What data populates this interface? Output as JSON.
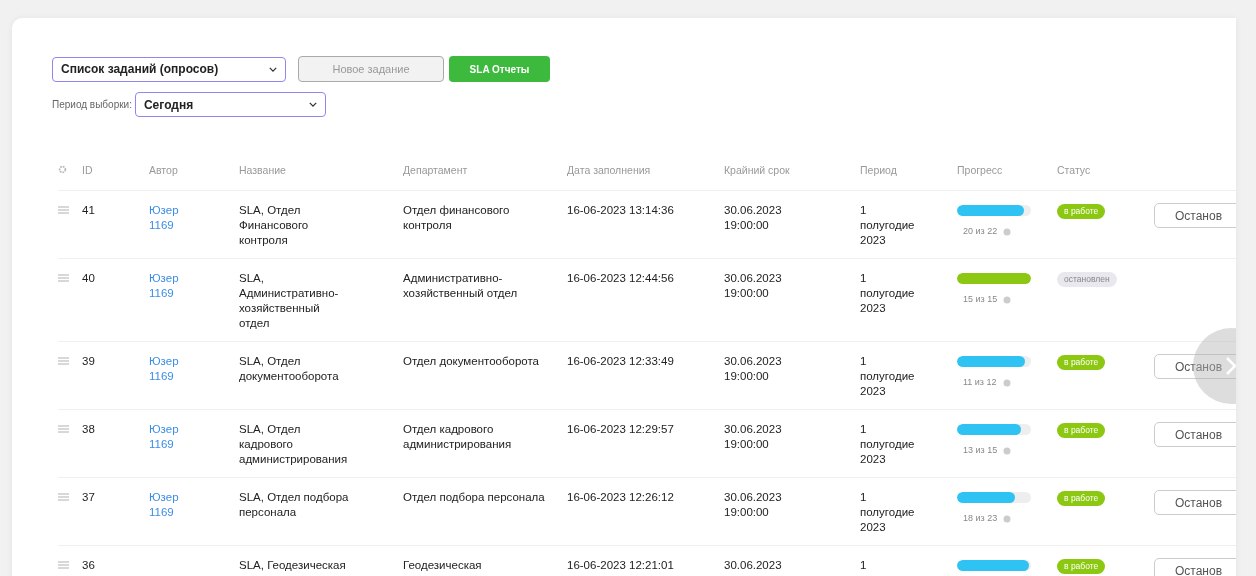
{
  "toolbar": {
    "list_select": {
      "value": "Список заданий (опросов)"
    },
    "buttons": [
      {
        "label": "Новое задание",
        "kind": "secondary"
      },
      {
        "label": "SLA Отчеты",
        "kind": "primary"
      }
    ],
    "period_label": "Период выборки:",
    "period_select": {
      "value": "Сегодня"
    }
  },
  "table": {
    "columns": [
      "ID",
      "Автор",
      "Название",
      "Департамент",
      "Дата заполнения",
      "Крайний срок",
      "Период",
      "Прогресс",
      "Статус"
    ],
    "rows": [
      {
        "id": "41",
        "author": "Юзер 1169",
        "name": "SLA, Отдел Финансового контроля",
        "department": "Отдел финансового контроля",
        "filled": "16-06-2023 13:14:36",
        "deadline": "30.06.2023 19:00:00",
        "period": "1 полугодие 2023",
        "level": 0.91,
        "progress": "20 из 22",
        "status": {
          "label": "в работе",
          "kind": "active"
        },
        "action": "Останов"
      },
      {
        "id": "40",
        "author": "Юзер 1169",
        "name": "SLA, Административно-хозяйственный отдел",
        "department": "Административно-хозяйственный отдел",
        "filled": "16-06-2023 12:44:56",
        "deadline": "30.06.2023 19:00:00",
        "period": "1 полугодие 2023",
        "level": 1,
        "progress": "15 из 15",
        "status": {
          "label": "остановлен",
          "kind": "stopped"
        }
      },
      {
        "id": "39",
        "author": "Юзер 1169",
        "name": "SLA, Отдел документооборота",
        "department": "Отдел документооборота",
        "filled": "16-06-2023 12:33:49",
        "deadline": "30.06.2023 19:00:00",
        "period": "1 полугодие 2023",
        "level": 0.92,
        "progress": "11 из 12",
        "status": {
          "label": "в работе",
          "kind": "active"
        },
        "action": "Останов"
      },
      {
        "id": "38",
        "author": "Юзер 1169",
        "name": "SLA, Отдел кадрового администрирования",
        "department": "Отдел кадрового администрирования",
        "filled": "16-06-2023 12:29:57",
        "deadline": "30.06.2023 19:00:00",
        "period": "1 полугодие 2023",
        "level": 0.87,
        "progress": "13 из 15",
        "status": {
          "label": "в работе",
          "kind": "active"
        },
        "action": "Останов"
      },
      {
        "id": "37",
        "author": "Юзер 1169",
        "name": "SLA, Отдел подбора персонала",
        "department": "Отдел подбора персонала",
        "filled": "16-06-2023 12:26:12",
        "deadline": "30.06.2023 19:00:00",
        "period": "1 полугодие 2023",
        "level": 0.78,
        "progress": "18 из 23",
        "status": {
          "label": "в работе",
          "kind": "active"
        },
        "action": "Останов"
      },
      {
        "id": "36",
        "name": "SLA, Геодезическая",
        "department": "Геодезическая",
        "filled": "16-06-2023 12:21:01",
        "deadline": "30.06.2023",
        "period": "1",
        "level": 0.97,
        "status": {
          "label": "в работе",
          "kind": "active"
        },
        "action": "Останов"
      }
    ]
  }
}
